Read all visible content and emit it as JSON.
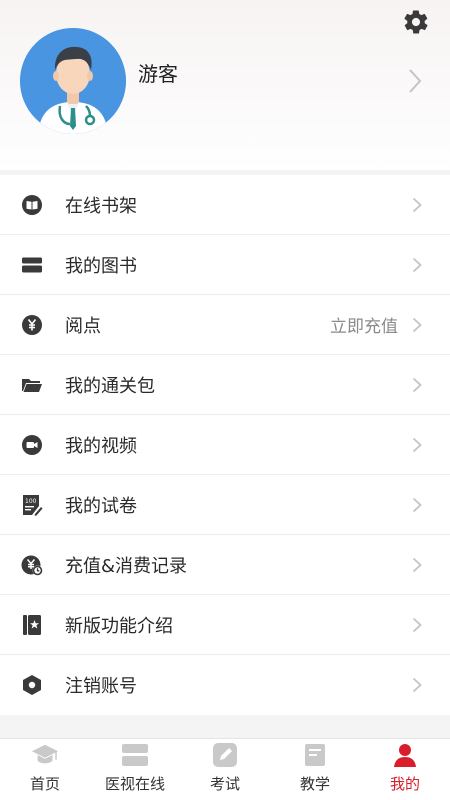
{
  "profile": {
    "username": "游客"
  },
  "menu": {
    "items": [
      {
        "label": "在线书架",
        "icon": "book-icon"
      },
      {
        "label": "我的图书",
        "icon": "books-icon"
      },
      {
        "label": "阅点",
        "icon": "yen-icon",
        "extra": "立即充值"
      },
      {
        "label": "我的通关包",
        "icon": "folder-icon"
      },
      {
        "label": "我的视频",
        "icon": "video-icon"
      },
      {
        "label": "我的试卷",
        "icon": "exam-paper-icon"
      },
      {
        "label": "充值&消费记录",
        "icon": "recharge-record-icon"
      },
      {
        "label": "新版功能介绍",
        "icon": "feature-intro-icon"
      },
      {
        "label": "注销账号",
        "icon": "hexagon-icon"
      }
    ]
  },
  "nav": {
    "items": [
      {
        "label": "首页",
        "icon": "graduation-cap-icon"
      },
      {
        "label": "医视在线",
        "icon": "media-icon"
      },
      {
        "label": "考试",
        "icon": "pencil-note-icon"
      },
      {
        "label": "教学",
        "icon": "teaching-icon"
      },
      {
        "label": "我的",
        "icon": "person-icon",
        "active": true
      }
    ]
  },
  "colors": {
    "accent": "#d81e2b",
    "avatar_bg": "#4a95e2",
    "icon": "#3a3a3a",
    "nav_icon": "#c9c9c9"
  }
}
